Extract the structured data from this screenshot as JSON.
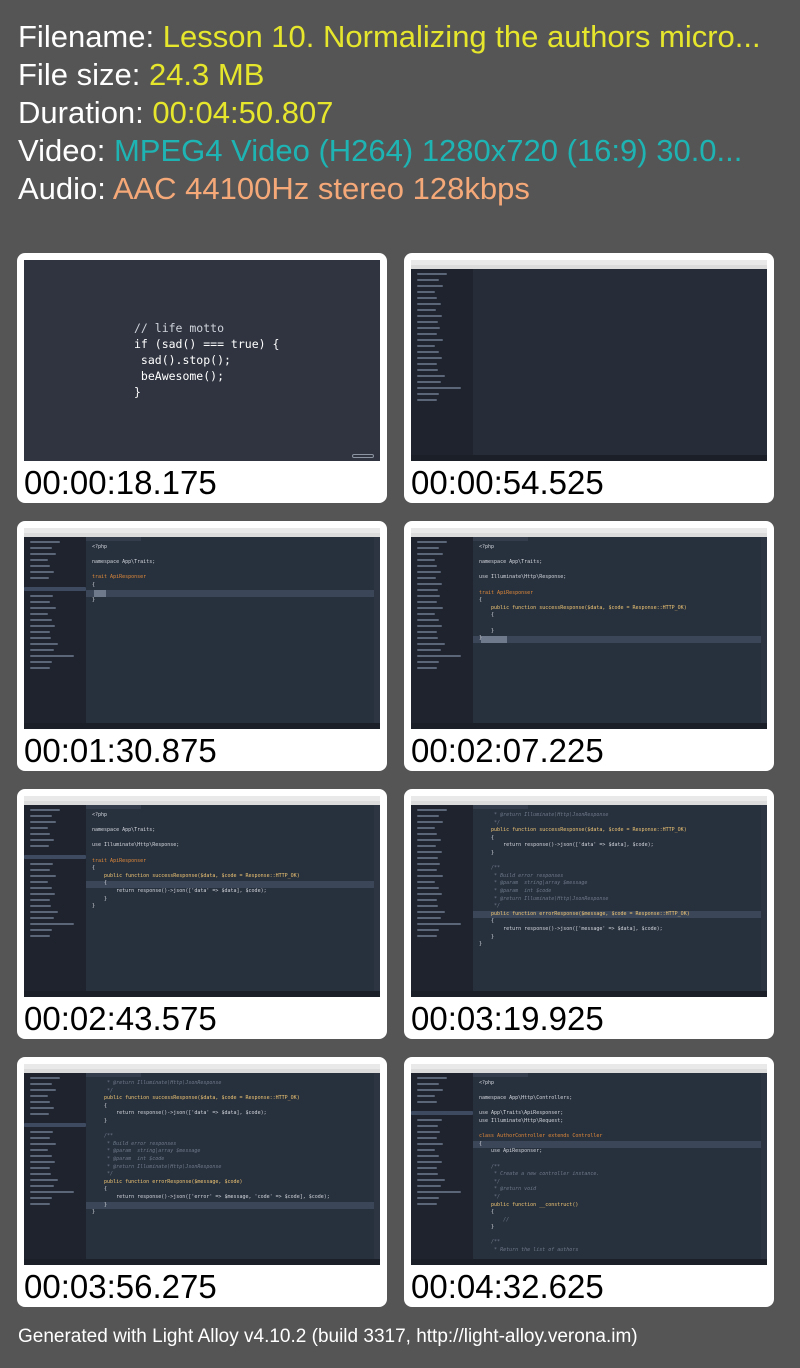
{
  "info": {
    "filename_key": "Filename:",
    "filename_value": "Lesson 10. Normalizing the authors micro...",
    "filesize_key": "File size:",
    "filesize_value": "24.3 MB",
    "duration_key": "Duration:",
    "duration_value": "00:04:50.807",
    "video_key": "Video:",
    "video_value": "MPEG4 Video (H264) 1280x720 (16:9) 30.0...",
    "audio_key": "Audio:",
    "audio_value": "AAC 44100Hz stereo 128kbps"
  },
  "thumbnails": [
    {
      "timestamp": "00:00:18.175"
    },
    {
      "timestamp": "00:00:54.525"
    },
    {
      "timestamp": "00:01:30.875"
    },
    {
      "timestamp": "00:02:07.225"
    },
    {
      "timestamp": "00:02:43.575"
    },
    {
      "timestamp": "00:03:19.925"
    },
    {
      "timestamp": "00:03:56.275"
    },
    {
      "timestamp": "00:04:32.625"
    }
  ],
  "motto": {
    "line1": "// life motto",
    "line2": "if (sad() === true) {",
    "line3": " sad().stop();",
    "line4": " beAwesome();",
    "line5": "}"
  },
  "code": {
    "php_open": "<?php",
    "namespace_traits": "namespace App\\Traits;",
    "use_response": "use Illuminate\\Http\\Response;",
    "trait_decl": "trait ApiResponser",
    "brace_open": "{",
    "brace_close": "}",
    "success_sig": "    public function successResponse($data, $code = Response::HTTP_OK)",
    "success_body": "        return response()->json(['data' => $data], $code);",
    "return_doc": "     * @return Illuminate\\Http\\JsonResponse",
    "doc_open": "    /**",
    "doc_build": "     * Build error responses",
    "doc_param_msg": "     * @param  string|array $message",
    "doc_param_code": "     * @param  int $code",
    "doc_close": "     */",
    "error_sig": "    public function errorResponse($message, $code = Response::HTTP_OK)",
    "error_sig2": "    public function errorResponse($message, $code)",
    "error_body": "        return response()->json(['message' => $data], $code);",
    "error_body2": "        return response()->json(['error' => $message, 'code' => $code], $code);",
    "namespace_ctrl": "namespace App\\Http\\Controllers;",
    "use_trait": "use App\\Traits\\ApiResponser;",
    "use_request": "use Illuminate\\Http\\Request;",
    "class_decl": "class AuthorController extends Controller",
    "use_api": "    use ApiResponser;",
    "doc_create": "     * Create a new controller instance.",
    "doc_return_void": "     * @return void",
    "construct": "    public function __construct()",
    "comment_slash": "        //",
    "doc_list": "     * Return the list of authors"
  },
  "footer": "Generated with Light Alloy v4.10.2 (build 3317, http://light-alloy.verona.im)"
}
